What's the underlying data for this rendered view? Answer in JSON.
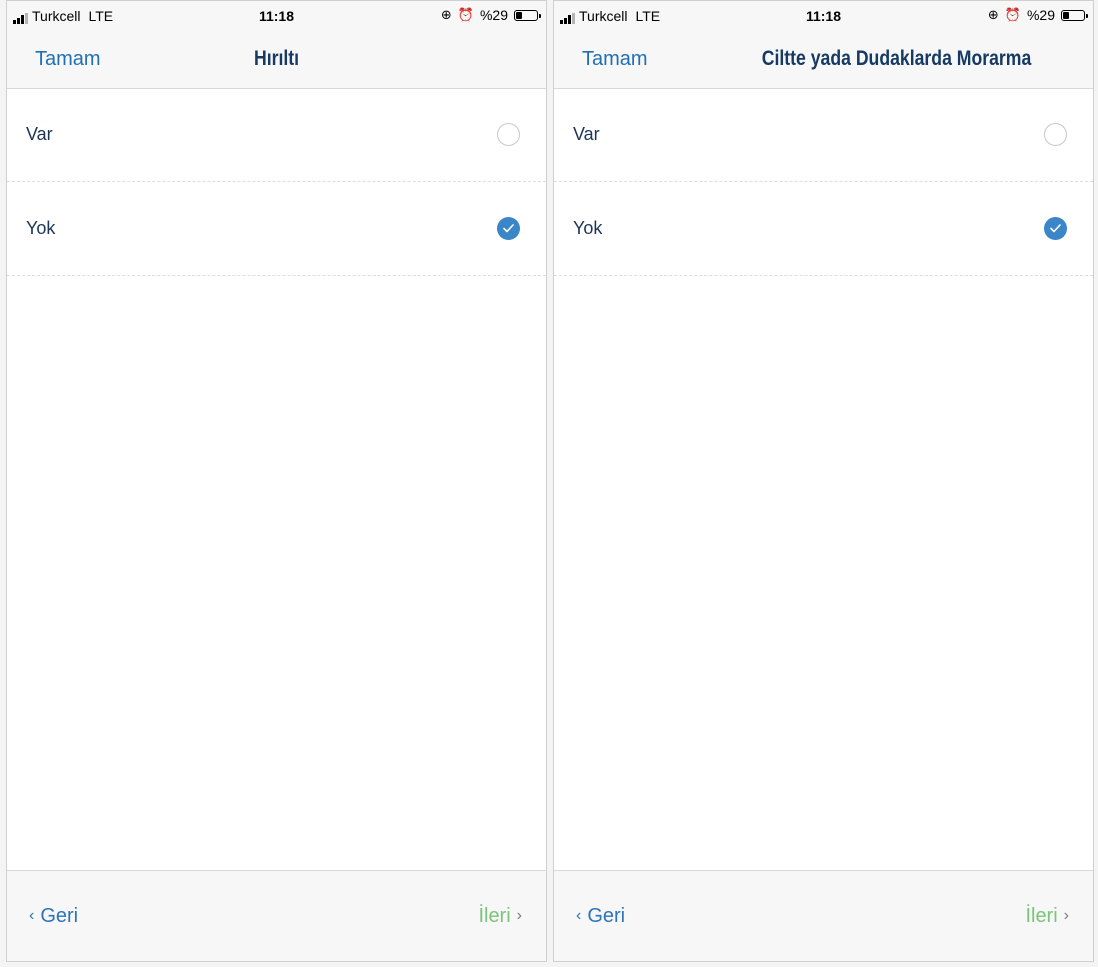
{
  "screens": [
    {
      "status": {
        "carrier": "Turkcell",
        "network": "LTE",
        "time": "11:18",
        "battery": "%29",
        "battery_level": 0.29
      },
      "nav": {
        "done_label": "Tamam",
        "title": "Hırıltı"
      },
      "options": [
        {
          "label": "Var",
          "selected": false
        },
        {
          "label": "Yok",
          "selected": true
        }
      ],
      "toolbar": {
        "back_label": "Geri",
        "next_label": "İleri"
      }
    },
    {
      "status": {
        "carrier": "Turkcell",
        "network": "LTE",
        "time": "11:18",
        "battery": "%29",
        "battery_level": 0.29
      },
      "nav": {
        "done_label": "Tamam",
        "title": "Ciltte yada Dudaklarda Morarma"
      },
      "options": [
        {
          "label": "Var",
          "selected": false
        },
        {
          "label": "Yok",
          "selected": true
        }
      ],
      "toolbar": {
        "back_label": "Geri",
        "next_label": "İleri"
      }
    }
  ],
  "colors": {
    "accent": "#1f6fb2",
    "title": "#163a63",
    "next": "#7bc47b",
    "check": "#3a86c8"
  }
}
